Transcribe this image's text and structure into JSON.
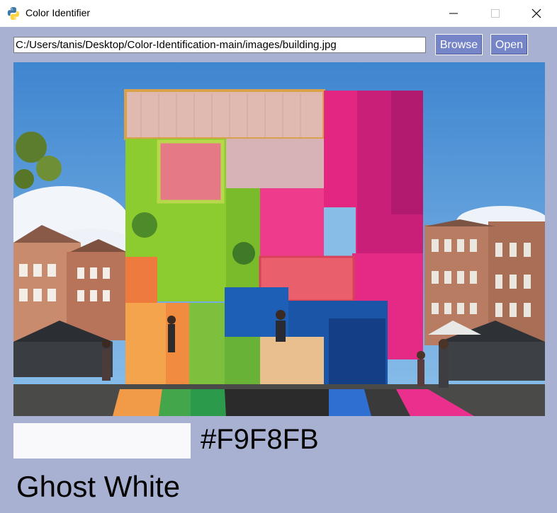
{
  "window": {
    "title": "Color Identifier",
    "icon": "python-icon"
  },
  "toolbar": {
    "path_value": "C:/Users/tanis/Desktop/Color-Identification-main/images/building.jpg",
    "browse_label": "Browse",
    "open_label": "Open"
  },
  "image": {
    "description_icon": "building-photo"
  },
  "result": {
    "hex": "#F9F8FB",
    "swatch_color": "#F9F8FB",
    "name": "Ghost White"
  },
  "colors": {
    "background": "#a9b1d3",
    "button": "#7684c8"
  }
}
